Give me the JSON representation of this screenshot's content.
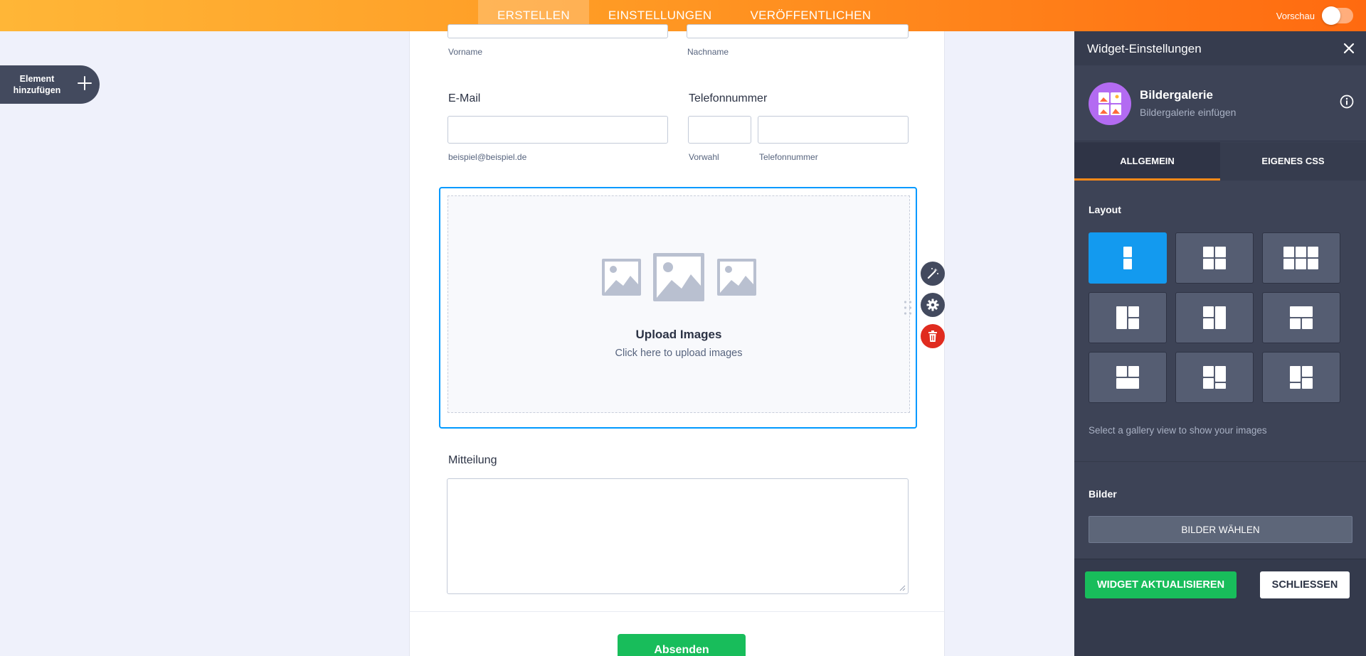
{
  "topbar": {
    "tabs": [
      {
        "label": "ERSTELLEN",
        "active": true
      },
      {
        "label": "EINSTELLUNGEN",
        "active": false
      },
      {
        "label": "VERÖFFENTLICHEN",
        "active": false
      }
    ],
    "preview_label": "Vorschau",
    "preview_on": false
  },
  "add_element": {
    "line1": "Element",
    "line2": "hinzufügen",
    "icon": "plus-icon"
  },
  "form": {
    "name": {
      "first_sublabel": "Vorname",
      "last_sublabel": "Nachname"
    },
    "email": {
      "label": "E-Mail",
      "sublabel": "beispiel@beispiel.de",
      "value": ""
    },
    "phone": {
      "label": "Telefonnummer",
      "area_sublabel": "Vorwahl",
      "number_sublabel": "Telefonnummer"
    },
    "gallery": {
      "title": "Upload Images",
      "subtitle": "Click here to upload images",
      "icon": "image-placeholder-icon"
    },
    "message": {
      "label": "Mitteilung",
      "value": ""
    },
    "submit_label": "Absenden",
    "tools": [
      "magic-wand-icon",
      "gear-icon",
      "trash-icon"
    ]
  },
  "panel": {
    "title": "Widget-Einstellungen",
    "widget": {
      "name": "Bildergalerie",
      "description": "Bildergalerie einfügen",
      "icon": "gallery-widget-icon"
    },
    "tabs": [
      {
        "label": "ALLGEMEIN",
        "active": true
      },
      {
        "label": "EIGENES CSS",
        "active": false
      }
    ],
    "layout_label": "Layout",
    "layout_selected_index": 0,
    "layout_hint": "Select a gallery view to show your images",
    "images_label": "Bilder",
    "choose_images_label": "BILDER WÄHLEN",
    "update_label": "WIDGET AKTUALISIEREN",
    "close_label": "SCHLIESSEN"
  },
  "colors": {
    "accent_orange": "#ff8a18",
    "selected_blue": "#139aef",
    "success_green": "#18bd5b",
    "danger_red": "#e02b1f",
    "panel_bg": "#3d4356"
  }
}
